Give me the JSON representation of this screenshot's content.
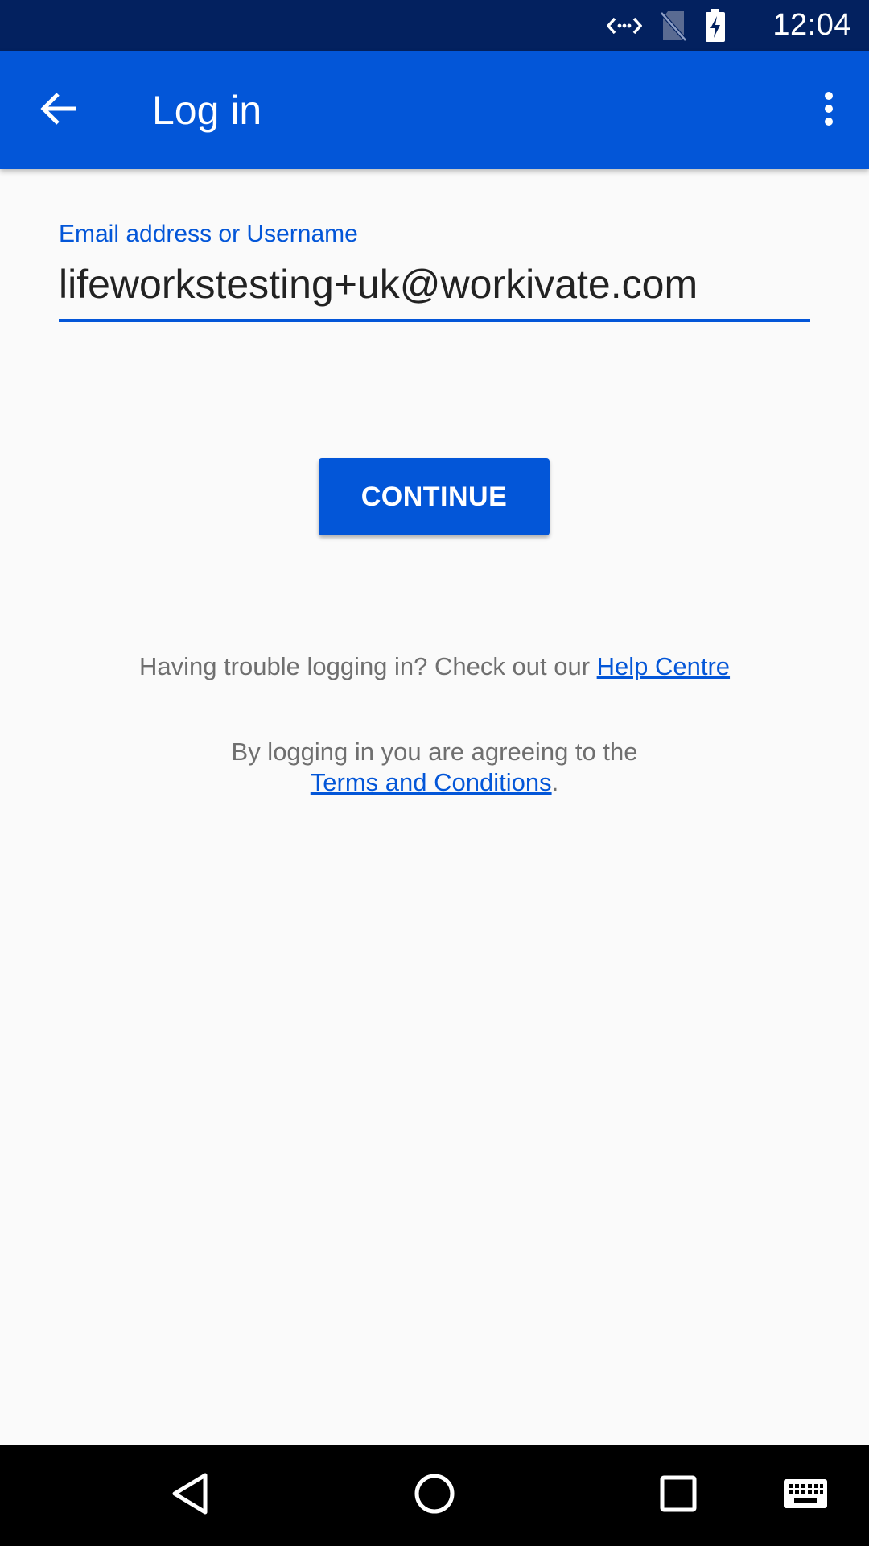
{
  "status_bar": {
    "time": "12:04",
    "icons": [
      "data-transfer-icon",
      "no-sim-icon",
      "battery-charging-icon"
    ]
  },
  "app_bar": {
    "title": "Log in",
    "back_icon": "arrow-back-icon",
    "menu_icon": "more-vert-icon"
  },
  "login_form": {
    "email_label": "Email address or Username",
    "email_value": "lifeworkstesting+uk@workivate.com",
    "continue_label": "CONTINUE"
  },
  "help": {
    "prefix": "Having trouble logging in? Check out our ",
    "link_label": "Help Centre"
  },
  "terms": {
    "line1": "By logging in you are agreeing to the",
    "link_label": "Terms and Conditions",
    "suffix": "."
  },
  "nav_bar": {
    "icons": [
      "back-triangle-icon",
      "home-circle-icon",
      "recents-square-icon",
      "keyboard-icon"
    ]
  },
  "colors": {
    "status_bar": "#03215f",
    "primary": "#0356d8",
    "background": "#fafafa",
    "muted_text": "#6f6f6f"
  }
}
